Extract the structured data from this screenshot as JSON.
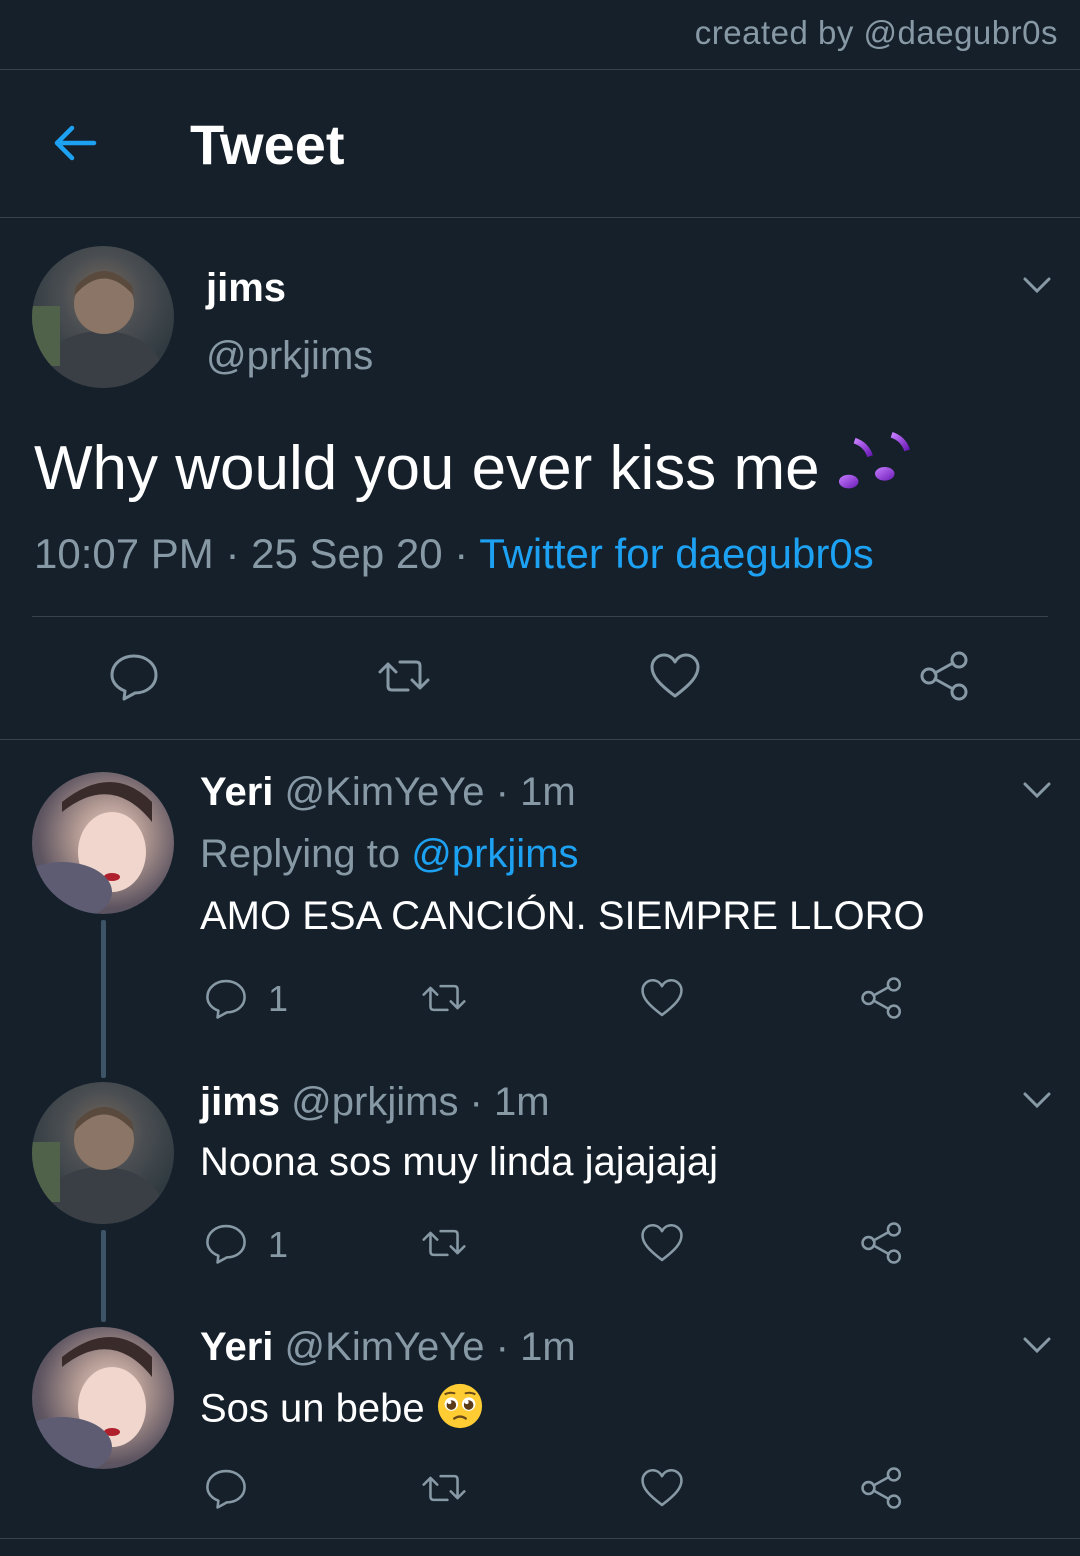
{
  "watermark": "created by @daegubr0s",
  "header": {
    "title": "Tweet"
  },
  "main_tweet": {
    "name": "jims",
    "handle": "@prkjims",
    "text": "Why would you ever kiss me",
    "text_emoji": "notes-emoji",
    "time": "10:07 PM",
    "date": "25 Sep 20",
    "source": "Twitter for daegubr0s",
    "sep": " · "
  },
  "replies": [
    {
      "name": "Yeri",
      "handle": "@KimYeYe",
      "age": "1m",
      "replying_label": "Replying to",
      "replying_to": "@prkjims",
      "text": "AMO ESA CANCIÓN. SIEMPRE LLORO",
      "reply_count": "1"
    },
    {
      "name": "jims",
      "handle": "@prkjims",
      "age": "1m",
      "text": "Noona sos muy linda jajajajaj",
      "reply_count": "1"
    },
    {
      "name": "Yeri",
      "handle": "@KimYeYe",
      "age": "1m",
      "text": "Sos un bebe",
      "text_emoji": "pleading-face-emoji",
      "reply_count": ""
    }
  ],
  "colors": {
    "background": "#15202b",
    "accent": "#1da1f2",
    "muted": "#8899a6",
    "divider": "#38444d"
  }
}
